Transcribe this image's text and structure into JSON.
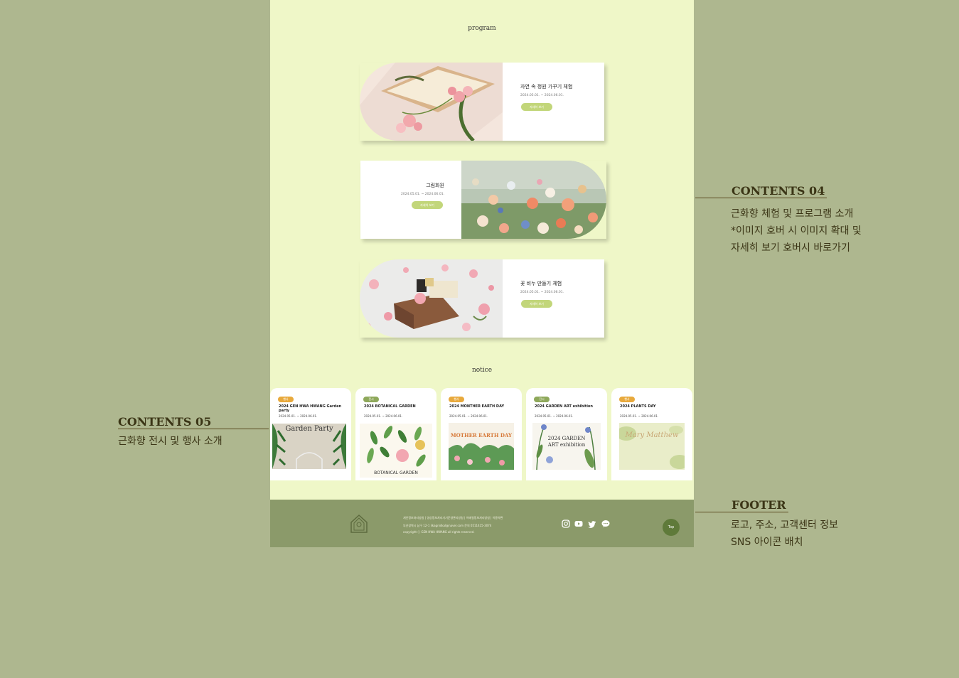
{
  "program": {
    "title": "program",
    "cards": [
      {
        "title": "자연 속 정원 가꾸기 체험",
        "date": "2024.05.01. ~ 2024.06.01.",
        "button": "자세히 보기"
      },
      {
        "title": "그림화원",
        "date": "2024.05.01. ~ 2024.06.01.",
        "button": "자세히 보기"
      },
      {
        "title": "꽃 비누 만들기 체험",
        "date": "2024.05.01. ~ 2024.06.01.",
        "button": "자세히 보기"
      }
    ]
  },
  "notice": {
    "title": "notice",
    "cards": [
      {
        "badge": "행사",
        "badge_color": "#e8a93c",
        "title": "2024 GEN HWA HWANG Garden party",
        "date": "2024.05.01. ~ 2024.06.01.",
        "image_text": "Garden Party"
      },
      {
        "badge": "전시",
        "badge_color": "#8ea85a",
        "title": "2024 BOTANICAL GARDEN",
        "date": "2024.05.01. ~ 2024.06.01.",
        "image_text": "BOTANICAL GARDEN"
      },
      {
        "badge": "행사",
        "badge_color": "#e8a93c",
        "title": "2024 MONTHER EARTH DAY",
        "date": "2024.05.01. ~ 2024.06.01.",
        "image_text": "MOTHER EARTH DAY"
      },
      {
        "badge": "전시",
        "badge_color": "#8ea85a",
        "title": "2024 GARDEN ART exhibition",
        "date": "2024.05.01. ~ 2024.06.01.",
        "image_text": "2024 GARDEN ART exhibition"
      },
      {
        "badge": "행사",
        "badge_color": "#e8a93c",
        "title": "2024 PLANTS DAY",
        "date": "2024.05.01. ~ 2024.06.01.",
        "image_text": "Mary Matthew"
      }
    ]
  },
  "footer": {
    "links": "개인정보처리방침   |   영상정보처리기기운영관리방침   |   이메일정보처리방침   |   이용약관",
    "address": "부산광역시 남구 12-1  ilkagnidkal@naver.com  문의 0511415-3074",
    "copyright": "copyright ⓒ GEN HWA HWANG all rights reserved.",
    "top_button": "Top",
    "sns_icons": [
      "instagram-icon",
      "youtube-icon",
      "twitter-icon",
      "chat-icon"
    ]
  },
  "annotations": {
    "contents04": {
      "title": "CONTENTS 04",
      "lines": [
        "근화향 체험 및 프로그램 소개",
        "*이미지 호버 시 이미지 확대 및",
        " 자세히 보기 호버시 바로가기"
      ]
    },
    "contents05": {
      "title": "CONTENTS 05",
      "lines": [
        "근화향 전시 및 행사 소개"
      ]
    },
    "footer": {
      "title": "FOOTER",
      "lines": [
        "로고, 주소, 고객센터 정보",
        "SNS 아이콘 배치"
      ]
    }
  },
  "colors": {
    "background": "#aeb78f",
    "page": "#eff7c8",
    "button": "#c2d67a",
    "footer": "#8b9a6a"
  }
}
